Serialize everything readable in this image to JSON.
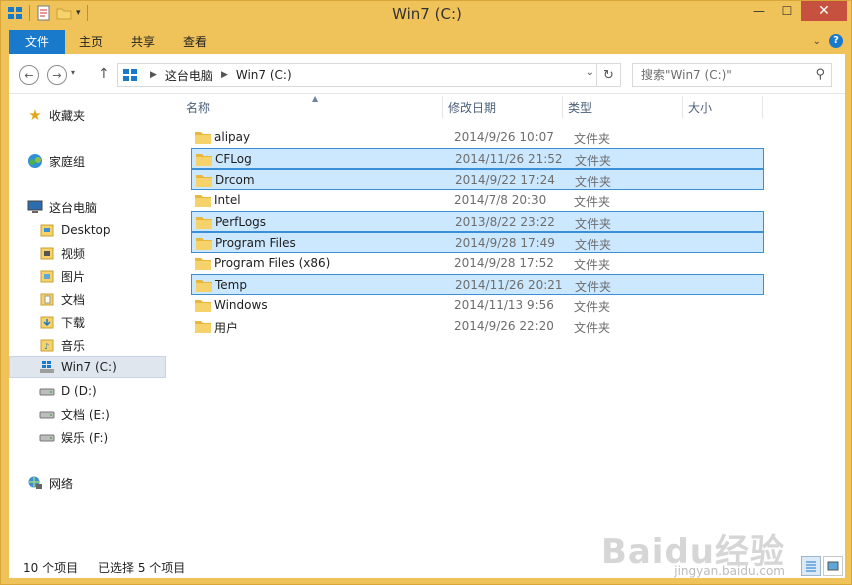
{
  "window": {
    "title": "Win7 (C:)"
  },
  "ribbon": {
    "tabs": [
      {
        "label": "文件"
      },
      {
        "label": "主页"
      },
      {
        "label": "共享"
      },
      {
        "label": "查看"
      }
    ]
  },
  "address": {
    "crumbs": [
      "这台电脑",
      "Win7 (C:)"
    ]
  },
  "search": {
    "placeholder": "搜索\"Win7 (C:)\""
  },
  "sidebar": {
    "favorites": "收藏夹",
    "homegroup": "家庭组",
    "this_pc": "这台电脑",
    "pc_items": [
      "Desktop",
      "视频",
      "图片",
      "文档",
      "下载",
      "音乐"
    ],
    "drives": [
      "Win7 (C:)",
      "D  (D:)",
      "文档 (E:)",
      "娱乐 (F:)"
    ],
    "network": "网络"
  },
  "columns": {
    "name": "名称",
    "date": "修改日期",
    "type": "类型",
    "size": "大小"
  },
  "files": [
    {
      "name": "alipay",
      "date": "2014/9/26 10:07",
      "type": "文件夹",
      "selected": false
    },
    {
      "name": "CFLog",
      "date": "2014/11/26 21:52",
      "type": "文件夹",
      "selected": true
    },
    {
      "name": "Drcom",
      "date": "2014/9/22 17:24",
      "type": "文件夹",
      "selected": true
    },
    {
      "name": "Intel",
      "date": "2014/7/8 20:30",
      "type": "文件夹",
      "selected": false
    },
    {
      "name": "PerfLogs",
      "date": "2013/8/22 23:22",
      "type": "文件夹",
      "selected": true
    },
    {
      "name": "Program Files",
      "date": "2014/9/28 17:49",
      "type": "文件夹",
      "selected": true
    },
    {
      "name": "Program Files (x86)",
      "date": "2014/9/28 17:52",
      "type": "文件夹",
      "selected": false
    },
    {
      "name": "Temp",
      "date": "2014/11/26 20:21",
      "type": "文件夹",
      "selected": true
    },
    {
      "name": "Windows",
      "date": "2014/11/13 9:56",
      "type": "文件夹",
      "selected": false
    },
    {
      "name": "用户",
      "date": "2014/9/26 22:20",
      "type": "文件夹",
      "selected": false
    }
  ],
  "status": {
    "count": "10 个项目",
    "selected": "已选择 5 个项目"
  },
  "watermark": {
    "brand": "Baidu经验",
    "url": "jingyan.baidu.com"
  },
  "colors": {
    "accent": "#1979ca",
    "titlebar": "#f0c35a",
    "selection": "#cce8ff",
    "folder": "#e8b73c"
  }
}
